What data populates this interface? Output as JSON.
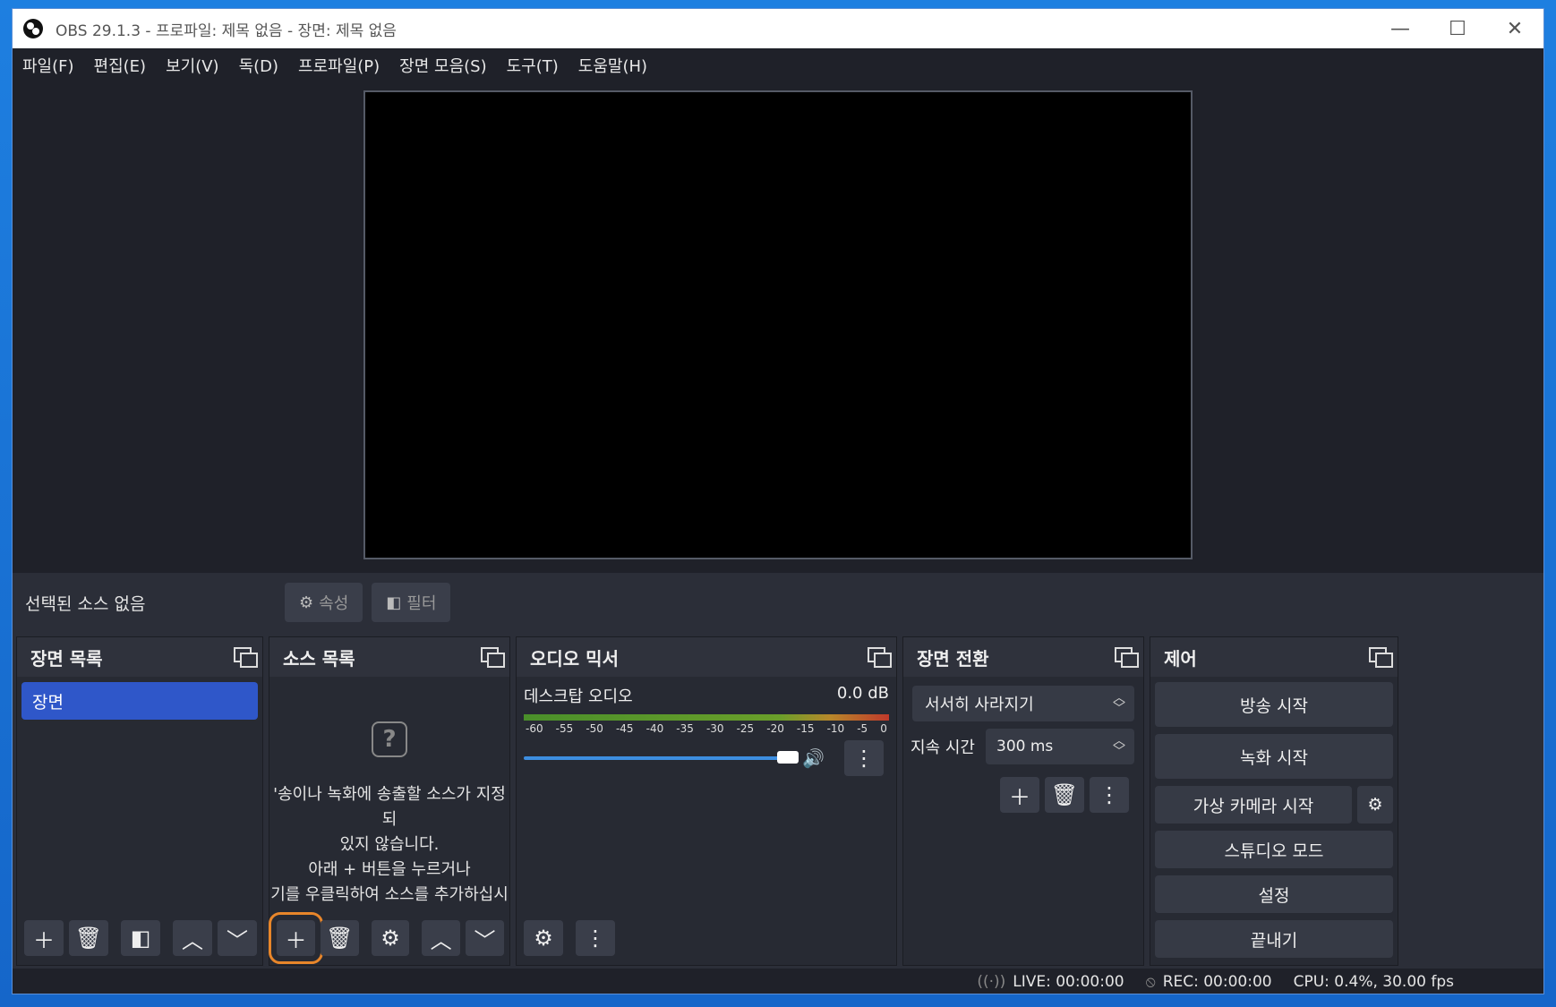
{
  "window": {
    "title": "OBS 29.1.3 - 프로파일: 제목 없음 - 장면: 제목 없음",
    "minimize": "—",
    "maximize": "☐",
    "close": "✕"
  },
  "menu": [
    "파일(F)",
    "편집(E)",
    "보기(V)",
    "독(D)",
    "프로파일(P)",
    "장면 모음(S)",
    "도구(T)",
    "도움말(H)"
  ],
  "source_toolbar": {
    "no_source_label": "선택된 소스 없음",
    "properties_label": "속성",
    "filters_label": "필터"
  },
  "scenes": {
    "title": "장면 목록",
    "items": [
      "장면"
    ]
  },
  "sources": {
    "title": "소스 목록",
    "empty_line1": "'송이나 녹화에 송출할 소스가 지정되",
    "empty_line2": "있지 않습니다.",
    "empty_line3": "아래 + 버튼을 누르거나",
    "empty_line4": "기를 우클릭하여 소스를 추가하십시"
  },
  "mixer": {
    "title": "오디오 믹서",
    "track_name": "데스크탑 오디오",
    "track_db": "0.0 dB",
    "ticks": [
      "-60",
      "-55",
      "-50",
      "-45",
      "-40",
      "-35",
      "-30",
      "-25",
      "-20",
      "-15",
      "-10",
      "-5",
      "0"
    ],
    "volume": 1.0
  },
  "transitions": {
    "title": "장면 전환",
    "selected": "서서히 사라지기",
    "duration_label": "지속 시간",
    "duration_value": "300 ms"
  },
  "controls": {
    "title": "제어",
    "start_streaming": "방송 시작",
    "start_recording": "녹화 시작",
    "start_virtualcam": "가상 카메라 시작",
    "studio_mode": "스튜디오 모드",
    "settings": "설정",
    "exit": "끝내기"
  },
  "status": {
    "live": "LIVE: 00:00:00",
    "rec": "REC: 00:00:00",
    "cpu": "CPU: 0.4%, 30.00 fps"
  },
  "colors": {
    "highlight": "#e8862a",
    "selected_scene": "#2f57c9",
    "background": "#2b2e38"
  }
}
